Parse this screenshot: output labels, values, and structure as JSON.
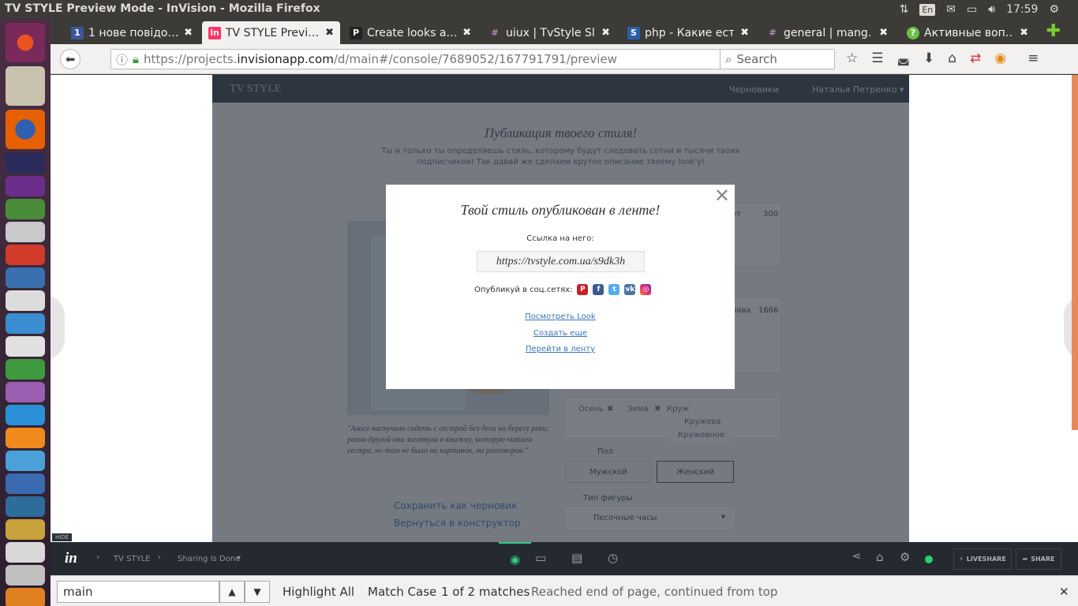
{
  "window": {
    "title": "TV STYLE Preview Mode - InVision - Mozilla Firefox"
  },
  "tray": {
    "lang": "En",
    "time": "17:59"
  },
  "tabs": [
    {
      "label": "1 нове повідо…",
      "fav": "1",
      "favColor": "#3b5998"
    },
    {
      "label": "TV STYLE Previ…",
      "fav": "in",
      "favColor": "#ff3366"
    },
    {
      "label": "Create looks a…",
      "fav": "P",
      "favColor": "#222222"
    },
    {
      "label": "uiux | TvStyle Sl…",
      "fav": "#",
      "favColor": "#6b2d6b"
    },
    {
      "label": "php - Какие ест…",
      "fav": "S",
      "favColor": "#2a5ea8"
    },
    {
      "label": "general | mang…",
      "fav": "#",
      "favColor": "#6b2d6b"
    },
    {
      "label": "Активные воп…",
      "fav": "?",
      "favColor": "#6bbf4a"
    }
  ],
  "nav": {
    "url_prefix": "https://projects.",
    "url_host": "invisionapp.com",
    "url_path": "/d/main#/console/7689052/167791791/preview",
    "search_placeholder": "Search"
  },
  "prototype": {
    "logo": "TV STYLE",
    "drafts": "Черновики",
    "user": "Наталья Петренко ▾",
    "heading": "Публикация твоего стиля!",
    "subheading": "Ты и только ты определяешь стиль, которому будут следовать сотни и тысячи твоих подписчиков! Так давай же сделаем крутое описание твоему look'у!",
    "quote": "\"Алисе наскучило сидеть с сестрой без дела на берегу реки; разок-другой она заглянула в книжку, которую читала сестра, но там не было ни картинок, ни разговоров.\"",
    "save_draft": "Сохранить как черновик",
    "back_constructor": "Вернуться в конструктор",
    "count_1": "300",
    "count_1_label": "ет",
    "count_2": "1666",
    "count_2_label": "рава",
    "tags": [
      "Осень",
      "Зима"
    ],
    "tag_input": "Круж",
    "suggestions": [
      "Кружева",
      "Кружевное"
    ],
    "gender_label": "Пол",
    "male": "Мужской",
    "female": "Женский",
    "figure_label": "Тип фигуры",
    "figure_value": "Песочные часы"
  },
  "modal": {
    "title": "Твой стиль опубликован в ленте!",
    "link_label": "Ссылка на него:",
    "link": "https://tvstyle.com.ua/s9dk3h",
    "share_label": "Опубликуй в соц.сетях:",
    "view_look": "Посмотреть Look",
    "create_more": "Создать еще",
    "go_feed": "Перейти в ленту"
  },
  "invision": {
    "hide": "HIDE",
    "project": "TV STYLE",
    "screen": "Sharing Is Done",
    "liveshare": "LIVESHARE",
    "share": "SHARE"
  },
  "find": {
    "query": "main",
    "highlight_all": "Highlight All",
    "match_case": "Match Case",
    "matches": "1 of 2 matches",
    "status": "Reached end of page, continued from top"
  }
}
